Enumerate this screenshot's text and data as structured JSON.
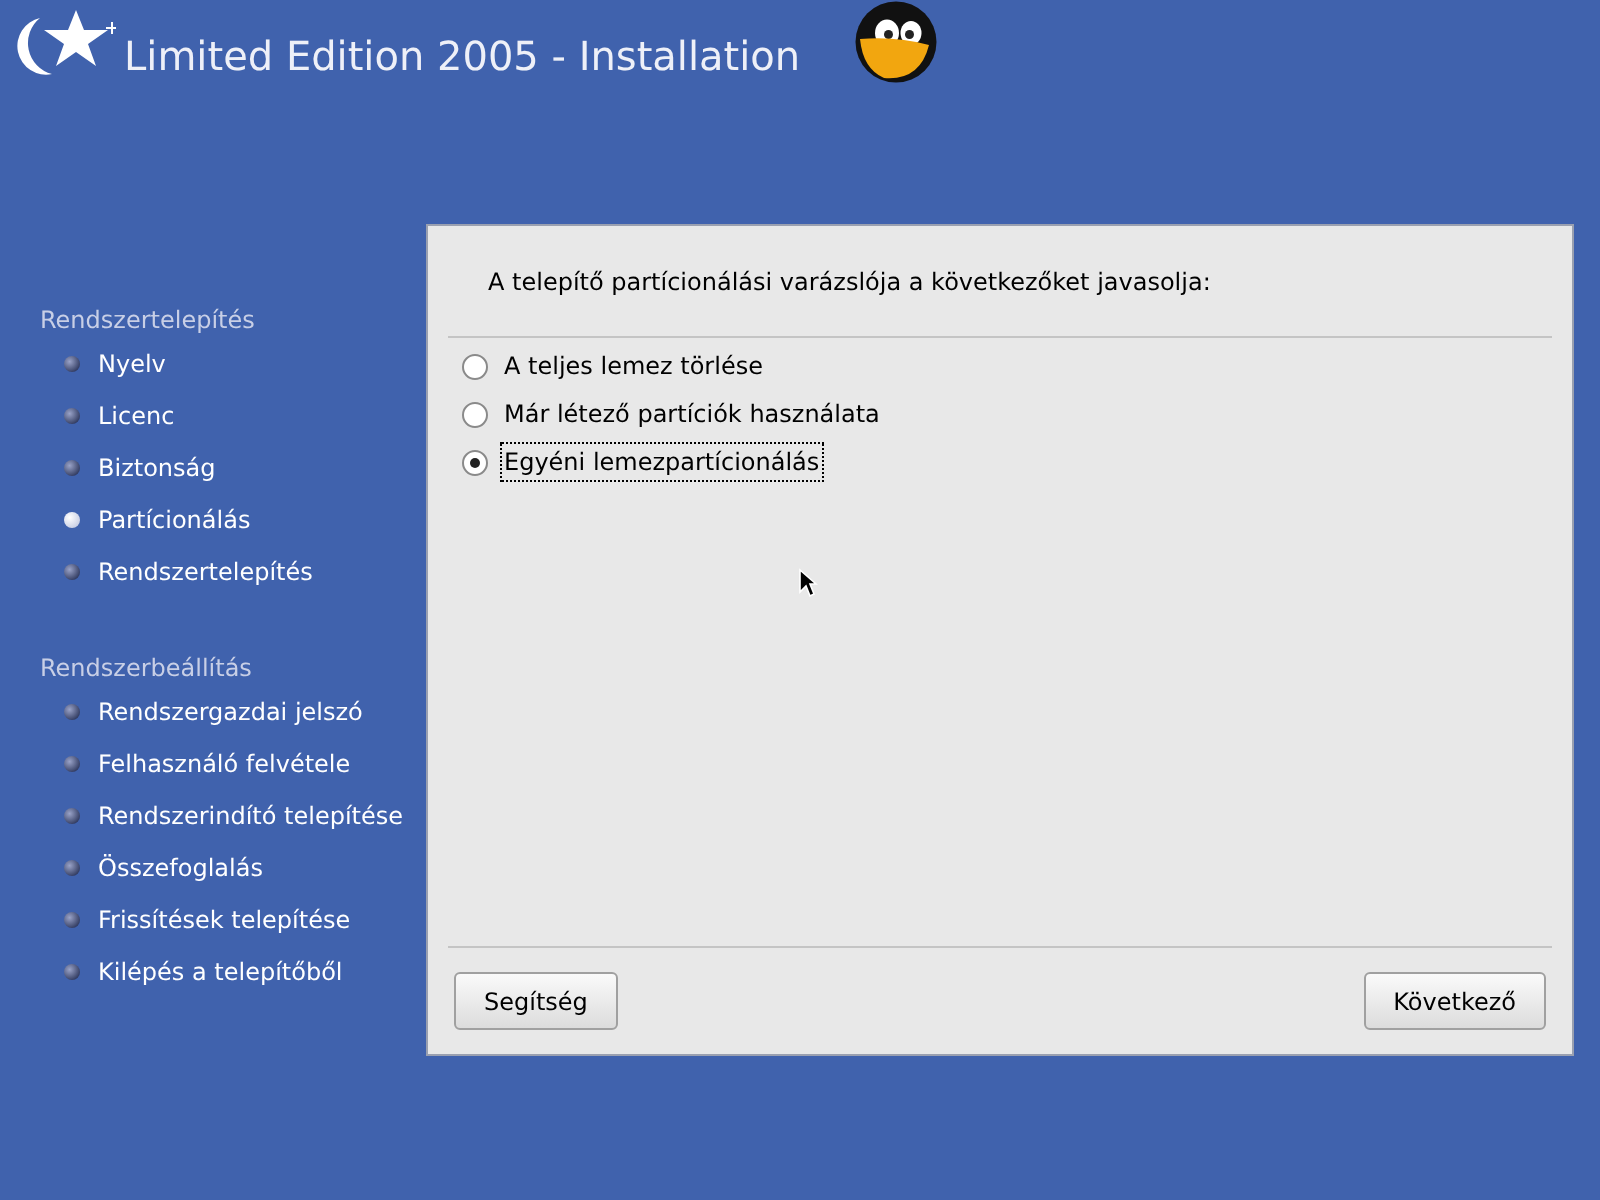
{
  "header": {
    "title": "Limited Edition 2005 - Installation"
  },
  "sidebar": {
    "sections": [
      {
        "title": "Rendszertelepítés",
        "items": [
          {
            "label": "Nyelv",
            "selected": false
          },
          {
            "label": "Licenc",
            "selected": false
          },
          {
            "label": "Biztonság",
            "selected": false
          },
          {
            "label": "Partícionálás",
            "selected": true
          },
          {
            "label": "Rendszertelepítés",
            "selected": false
          }
        ]
      },
      {
        "title": "Rendszerbeállítás",
        "items": [
          {
            "label": "Rendszergazdai jelszó",
            "selected": false
          },
          {
            "label": "Felhasználó felvétele",
            "selected": false
          },
          {
            "label": "Rendszerindító telepítése",
            "selected": false
          },
          {
            "label": "Összefoglalás",
            "selected": false
          },
          {
            "label": "Frissítések telepítése",
            "selected": false
          },
          {
            "label": "Kilépés a telepítőből",
            "selected": false
          }
        ]
      }
    ]
  },
  "panel": {
    "prompt": "A telepítő partícionálási varázslója a következőket javasolja:",
    "options": [
      {
        "label": "A teljes lemez törlése",
        "selected": false
      },
      {
        "label": "Már létező partíciók használata",
        "selected": false
      },
      {
        "label": "Egyéni lemezpartícionálás",
        "selected": true
      }
    ],
    "buttons": [
      "Segítség",
      "Következő"
    ]
  }
}
